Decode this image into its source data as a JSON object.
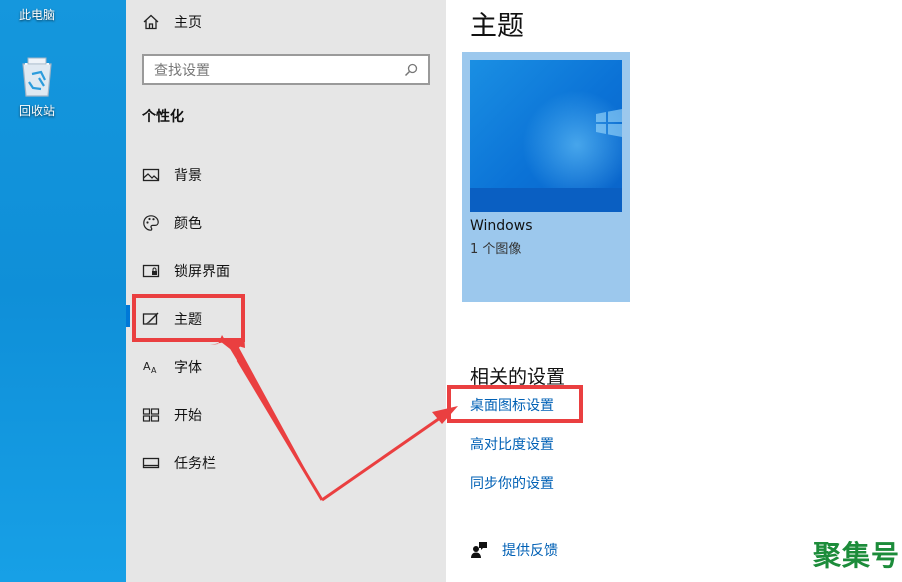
{
  "desktop": {
    "icons": [
      {
        "label": "此电脑",
        "icon": "computer-icon"
      },
      {
        "label": "回收站",
        "icon": "recycle-bin-icon"
      }
    ]
  },
  "sidebar": {
    "home_label": "主页",
    "search_placeholder": "查找设置",
    "section_title": "个性化",
    "items": [
      {
        "label": "背景",
        "icon": "picture-icon"
      },
      {
        "label": "颜色",
        "icon": "palette-icon"
      },
      {
        "label": "锁屏界面",
        "icon": "lock-screen-icon"
      },
      {
        "label": "主题",
        "icon": "theme-brush-icon",
        "selected": true
      },
      {
        "label": "字体",
        "icon": "font-icon"
      },
      {
        "label": "开始",
        "icon": "start-icon"
      },
      {
        "label": "任务栏",
        "icon": "taskbar-icon"
      }
    ]
  },
  "main": {
    "title": "主题",
    "theme": {
      "name": "Windows",
      "count": "1 个图像"
    },
    "related_title": "相关的设置",
    "links": [
      "桌面图标设置",
      "高对比度设置",
      "同步你的设置"
    ],
    "feedback_label": "提供反馈"
  },
  "watermark": "聚集号",
  "colors": {
    "accent": "#0078d7",
    "link": "#0060b5",
    "annotation": "#ea3f40",
    "watermark": "#1c8c3a"
  }
}
